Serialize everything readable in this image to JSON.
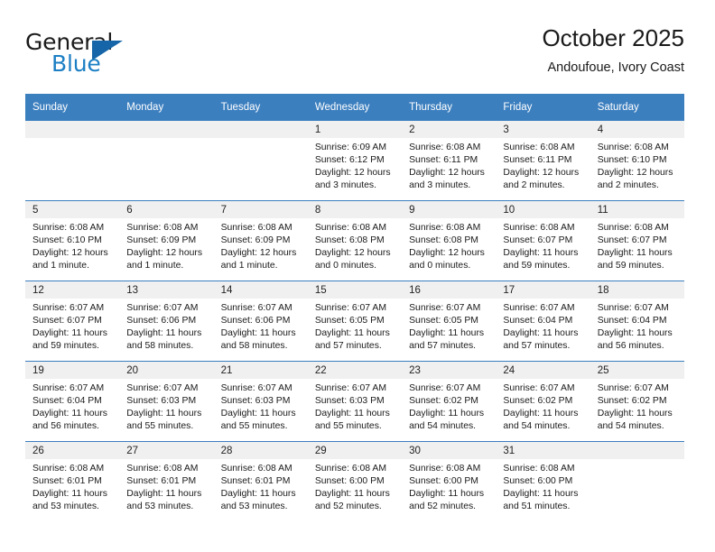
{
  "logo": {
    "primary_text": "General",
    "secondary_text": "Blue",
    "triangle_color": "#1565a8",
    "blue_color": "#1c7fc4"
  },
  "header": {
    "title": "October 2025",
    "subtitle": "Andoufoue, Ivory Coast"
  },
  "theme": {
    "header_bar_color": "#3c7fbf",
    "day_band_color": "#f0f0f0",
    "text_color": "#1a1a1a"
  },
  "weekday_headers": [
    "Sunday",
    "Monday",
    "Tuesday",
    "Wednesday",
    "Thursday",
    "Friday",
    "Saturday"
  ],
  "weeks": [
    [
      {
        "day": "",
        "sunrise": "",
        "sunset": "",
        "daylight_line1": "",
        "daylight_line2": ""
      },
      {
        "day": "",
        "sunrise": "",
        "sunset": "",
        "daylight_line1": "",
        "daylight_line2": ""
      },
      {
        "day": "",
        "sunrise": "",
        "sunset": "",
        "daylight_line1": "",
        "daylight_line2": ""
      },
      {
        "day": "1",
        "sunrise": "Sunrise: 6:09 AM",
        "sunset": "Sunset: 6:12 PM",
        "daylight_line1": "Daylight: 12 hours",
        "daylight_line2": "and 3 minutes."
      },
      {
        "day": "2",
        "sunrise": "Sunrise: 6:08 AM",
        "sunset": "Sunset: 6:11 PM",
        "daylight_line1": "Daylight: 12 hours",
        "daylight_line2": "and 3 minutes."
      },
      {
        "day": "3",
        "sunrise": "Sunrise: 6:08 AM",
        "sunset": "Sunset: 6:11 PM",
        "daylight_line1": "Daylight: 12 hours",
        "daylight_line2": "and 2 minutes."
      },
      {
        "day": "4",
        "sunrise": "Sunrise: 6:08 AM",
        "sunset": "Sunset: 6:10 PM",
        "daylight_line1": "Daylight: 12 hours",
        "daylight_line2": "and 2 minutes."
      }
    ],
    [
      {
        "day": "5",
        "sunrise": "Sunrise: 6:08 AM",
        "sunset": "Sunset: 6:10 PM",
        "daylight_line1": "Daylight: 12 hours",
        "daylight_line2": "and 1 minute."
      },
      {
        "day": "6",
        "sunrise": "Sunrise: 6:08 AM",
        "sunset": "Sunset: 6:09 PM",
        "daylight_line1": "Daylight: 12 hours",
        "daylight_line2": "and 1 minute."
      },
      {
        "day": "7",
        "sunrise": "Sunrise: 6:08 AM",
        "sunset": "Sunset: 6:09 PM",
        "daylight_line1": "Daylight: 12 hours",
        "daylight_line2": "and 1 minute."
      },
      {
        "day": "8",
        "sunrise": "Sunrise: 6:08 AM",
        "sunset": "Sunset: 6:08 PM",
        "daylight_line1": "Daylight: 12 hours",
        "daylight_line2": "and 0 minutes."
      },
      {
        "day": "9",
        "sunrise": "Sunrise: 6:08 AM",
        "sunset": "Sunset: 6:08 PM",
        "daylight_line1": "Daylight: 12 hours",
        "daylight_line2": "and 0 minutes."
      },
      {
        "day": "10",
        "sunrise": "Sunrise: 6:08 AM",
        "sunset": "Sunset: 6:07 PM",
        "daylight_line1": "Daylight: 11 hours",
        "daylight_line2": "and 59 minutes."
      },
      {
        "day": "11",
        "sunrise": "Sunrise: 6:08 AM",
        "sunset": "Sunset: 6:07 PM",
        "daylight_line1": "Daylight: 11 hours",
        "daylight_line2": "and 59 minutes."
      }
    ],
    [
      {
        "day": "12",
        "sunrise": "Sunrise: 6:07 AM",
        "sunset": "Sunset: 6:07 PM",
        "daylight_line1": "Daylight: 11 hours",
        "daylight_line2": "and 59 minutes."
      },
      {
        "day": "13",
        "sunrise": "Sunrise: 6:07 AM",
        "sunset": "Sunset: 6:06 PM",
        "daylight_line1": "Daylight: 11 hours",
        "daylight_line2": "and 58 minutes."
      },
      {
        "day": "14",
        "sunrise": "Sunrise: 6:07 AM",
        "sunset": "Sunset: 6:06 PM",
        "daylight_line1": "Daylight: 11 hours",
        "daylight_line2": "and 58 minutes."
      },
      {
        "day": "15",
        "sunrise": "Sunrise: 6:07 AM",
        "sunset": "Sunset: 6:05 PM",
        "daylight_line1": "Daylight: 11 hours",
        "daylight_line2": "and 57 minutes."
      },
      {
        "day": "16",
        "sunrise": "Sunrise: 6:07 AM",
        "sunset": "Sunset: 6:05 PM",
        "daylight_line1": "Daylight: 11 hours",
        "daylight_line2": "and 57 minutes."
      },
      {
        "day": "17",
        "sunrise": "Sunrise: 6:07 AM",
        "sunset": "Sunset: 6:04 PM",
        "daylight_line1": "Daylight: 11 hours",
        "daylight_line2": "and 57 minutes."
      },
      {
        "day": "18",
        "sunrise": "Sunrise: 6:07 AM",
        "sunset": "Sunset: 6:04 PM",
        "daylight_line1": "Daylight: 11 hours",
        "daylight_line2": "and 56 minutes."
      }
    ],
    [
      {
        "day": "19",
        "sunrise": "Sunrise: 6:07 AM",
        "sunset": "Sunset: 6:04 PM",
        "daylight_line1": "Daylight: 11 hours",
        "daylight_line2": "and 56 minutes."
      },
      {
        "day": "20",
        "sunrise": "Sunrise: 6:07 AM",
        "sunset": "Sunset: 6:03 PM",
        "daylight_line1": "Daylight: 11 hours",
        "daylight_line2": "and 55 minutes."
      },
      {
        "day": "21",
        "sunrise": "Sunrise: 6:07 AM",
        "sunset": "Sunset: 6:03 PM",
        "daylight_line1": "Daylight: 11 hours",
        "daylight_line2": "and 55 minutes."
      },
      {
        "day": "22",
        "sunrise": "Sunrise: 6:07 AM",
        "sunset": "Sunset: 6:03 PM",
        "daylight_line1": "Daylight: 11 hours",
        "daylight_line2": "and 55 minutes."
      },
      {
        "day": "23",
        "sunrise": "Sunrise: 6:07 AM",
        "sunset": "Sunset: 6:02 PM",
        "daylight_line1": "Daylight: 11 hours",
        "daylight_line2": "and 54 minutes."
      },
      {
        "day": "24",
        "sunrise": "Sunrise: 6:07 AM",
        "sunset": "Sunset: 6:02 PM",
        "daylight_line1": "Daylight: 11 hours",
        "daylight_line2": "and 54 minutes."
      },
      {
        "day": "25",
        "sunrise": "Sunrise: 6:07 AM",
        "sunset": "Sunset: 6:02 PM",
        "daylight_line1": "Daylight: 11 hours",
        "daylight_line2": "and 54 minutes."
      }
    ],
    [
      {
        "day": "26",
        "sunrise": "Sunrise: 6:08 AM",
        "sunset": "Sunset: 6:01 PM",
        "daylight_line1": "Daylight: 11 hours",
        "daylight_line2": "and 53 minutes."
      },
      {
        "day": "27",
        "sunrise": "Sunrise: 6:08 AM",
        "sunset": "Sunset: 6:01 PM",
        "daylight_line1": "Daylight: 11 hours",
        "daylight_line2": "and 53 minutes."
      },
      {
        "day": "28",
        "sunrise": "Sunrise: 6:08 AM",
        "sunset": "Sunset: 6:01 PM",
        "daylight_line1": "Daylight: 11 hours",
        "daylight_line2": "and 53 minutes."
      },
      {
        "day": "29",
        "sunrise": "Sunrise: 6:08 AM",
        "sunset": "Sunset: 6:00 PM",
        "daylight_line1": "Daylight: 11 hours",
        "daylight_line2": "and 52 minutes."
      },
      {
        "day": "30",
        "sunrise": "Sunrise: 6:08 AM",
        "sunset": "Sunset: 6:00 PM",
        "daylight_line1": "Daylight: 11 hours",
        "daylight_line2": "and 52 minutes."
      },
      {
        "day": "31",
        "sunrise": "Sunrise: 6:08 AM",
        "sunset": "Sunset: 6:00 PM",
        "daylight_line1": "Daylight: 11 hours",
        "daylight_line2": "and 51 minutes."
      },
      {
        "day": "",
        "sunrise": "",
        "sunset": "",
        "daylight_line1": "",
        "daylight_line2": ""
      }
    ]
  ]
}
